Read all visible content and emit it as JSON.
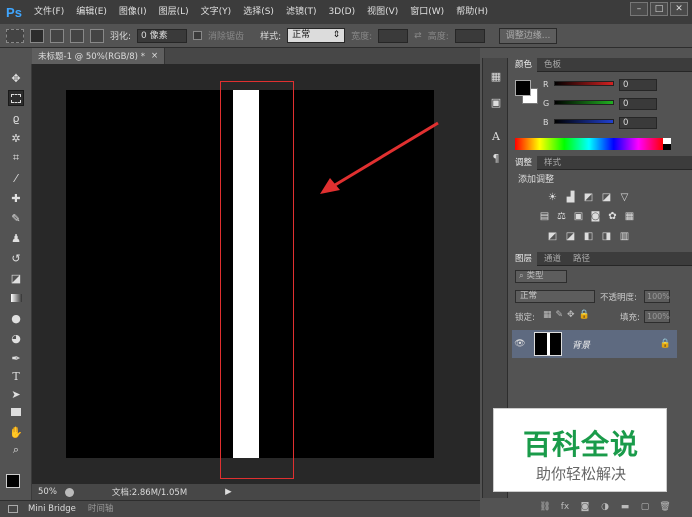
{
  "app": {
    "logo": "Ps"
  },
  "menu": [
    "文件(F)",
    "编辑(E)",
    "图像(I)",
    "图层(L)",
    "文字(Y)",
    "选择(S)",
    "滤镜(T)",
    "3D(D)",
    "视图(V)",
    "窗口(W)",
    "帮助(H)"
  ],
  "window_controls": {
    "minimize": "–",
    "restore": "□",
    "close": "✕"
  },
  "options": {
    "feather_label": "羽化:",
    "feather_value": "0 像素",
    "antialias_label": "消除锯齿",
    "style_label": "样式:",
    "style_value": "正常",
    "width_label": "宽度:",
    "height_label": "高度:",
    "refine_edge_button": "调整边缘..."
  },
  "document_tab": {
    "title": "未标题-1 @ 50%(RGB/8) *",
    "close": "×"
  },
  "status": {
    "zoom": "50%",
    "doc_info": "文档:2.86M/1.05M"
  },
  "bottom_tabs": [
    "Mini Bridge",
    "时间轴"
  ],
  "color_panel": {
    "tabs": [
      "颜色",
      "色板"
    ],
    "channels": [
      {
        "label": "R",
        "value": "0",
        "color": "#d42020"
      },
      {
        "label": "G",
        "value": "0",
        "color": "#20b020"
      },
      {
        "label": "B",
        "value": "0",
        "color": "#2040d0"
      }
    ]
  },
  "adjustments_panel": {
    "tabs": [
      "调整",
      "样式"
    ],
    "heading": "添加调整"
  },
  "layers_panel": {
    "tabs": [
      "图层",
      "通道",
      "路径"
    ],
    "filter_label": "类型",
    "blend_mode": "正常",
    "opacity_label": "不透明度:",
    "opacity_value": "100%",
    "lock_label": "锁定:",
    "fill_label": "填充:",
    "fill_value": "100%",
    "layers": [
      {
        "name": "背景",
        "visible": true,
        "locked": true
      }
    ]
  },
  "watermark": {
    "title": "百科全说",
    "subtitle": "助你轻松解决"
  },
  "colors": {
    "accent_blue": "#3fa6ff",
    "highlight_red": "#e03030",
    "watermark_green": "#1a9b4a"
  }
}
